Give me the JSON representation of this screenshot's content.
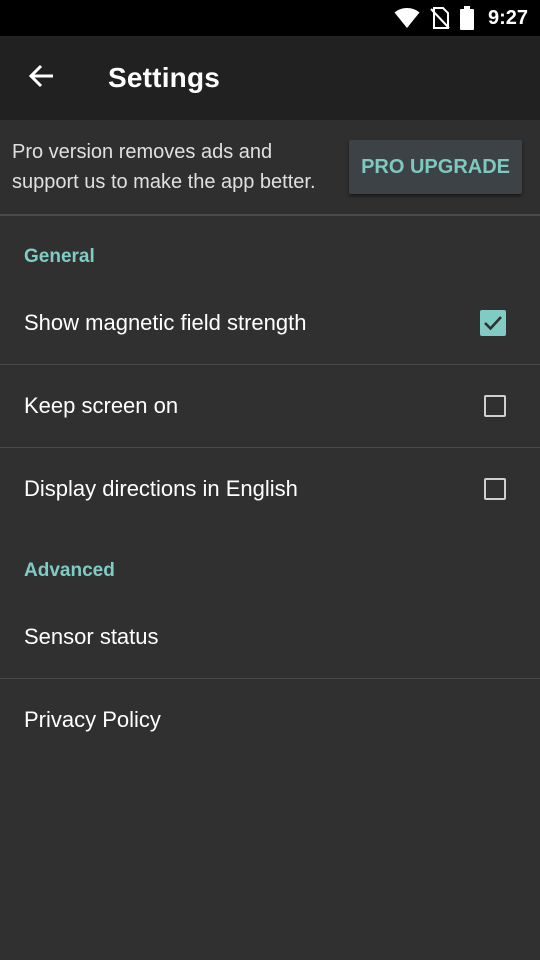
{
  "statusbar": {
    "time": "9:27",
    "icons": [
      "wifi-icon",
      "no-sim-icon",
      "battery-icon"
    ]
  },
  "appbar": {
    "title": "Settings",
    "back_icon": "arrow-back-icon"
  },
  "promo": {
    "text": "Pro version removes ads and support us to make the app better.",
    "button_label": "PRO UPGRADE"
  },
  "general": {
    "header": "General",
    "items": [
      {
        "label": "Show magnetic field strength",
        "checked": true
      },
      {
        "label": "Keep screen on",
        "checked": false
      },
      {
        "label": "Display directions in English",
        "checked": false
      }
    ]
  },
  "advanced": {
    "header": "Advanced",
    "items": [
      {
        "label": "Sensor status"
      },
      {
        "label": "Privacy Policy"
      }
    ]
  },
  "colors": {
    "accent": "#80cbc4",
    "background": "#303030",
    "appbar": "#212121",
    "statusbar": "#000000"
  }
}
